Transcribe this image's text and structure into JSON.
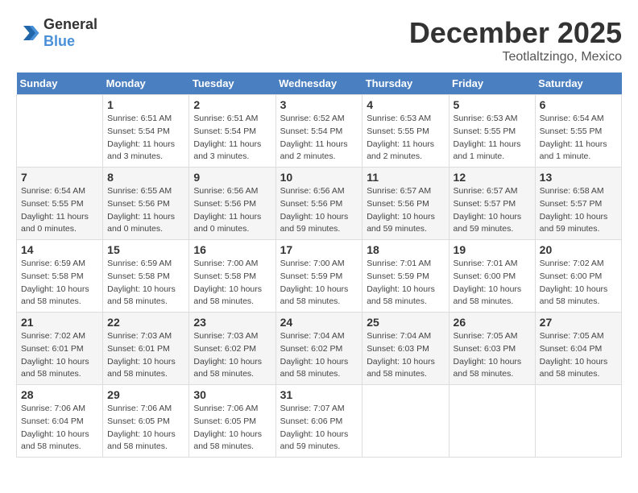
{
  "header": {
    "logo_general": "General",
    "logo_blue": "Blue",
    "month": "December 2025",
    "location": "Teotlaltzingo, Mexico"
  },
  "weekdays": [
    "Sunday",
    "Monday",
    "Tuesday",
    "Wednesday",
    "Thursday",
    "Friday",
    "Saturday"
  ],
  "weeks": [
    [
      {
        "day": "",
        "info": ""
      },
      {
        "day": "1",
        "info": "Sunrise: 6:51 AM\nSunset: 5:54 PM\nDaylight: 11 hours\nand 3 minutes."
      },
      {
        "day": "2",
        "info": "Sunrise: 6:51 AM\nSunset: 5:54 PM\nDaylight: 11 hours\nand 3 minutes."
      },
      {
        "day": "3",
        "info": "Sunrise: 6:52 AM\nSunset: 5:54 PM\nDaylight: 11 hours\nand 2 minutes."
      },
      {
        "day": "4",
        "info": "Sunrise: 6:53 AM\nSunset: 5:55 PM\nDaylight: 11 hours\nand 2 minutes."
      },
      {
        "day": "5",
        "info": "Sunrise: 6:53 AM\nSunset: 5:55 PM\nDaylight: 11 hours\nand 1 minute."
      },
      {
        "day": "6",
        "info": "Sunrise: 6:54 AM\nSunset: 5:55 PM\nDaylight: 11 hours\nand 1 minute."
      }
    ],
    [
      {
        "day": "7",
        "info": "Sunrise: 6:54 AM\nSunset: 5:55 PM\nDaylight: 11 hours\nand 0 minutes."
      },
      {
        "day": "8",
        "info": "Sunrise: 6:55 AM\nSunset: 5:56 PM\nDaylight: 11 hours\nand 0 minutes."
      },
      {
        "day": "9",
        "info": "Sunrise: 6:56 AM\nSunset: 5:56 PM\nDaylight: 11 hours\nand 0 minutes."
      },
      {
        "day": "10",
        "info": "Sunrise: 6:56 AM\nSunset: 5:56 PM\nDaylight: 10 hours\nand 59 minutes."
      },
      {
        "day": "11",
        "info": "Sunrise: 6:57 AM\nSunset: 5:56 PM\nDaylight: 10 hours\nand 59 minutes."
      },
      {
        "day": "12",
        "info": "Sunrise: 6:57 AM\nSunset: 5:57 PM\nDaylight: 10 hours\nand 59 minutes."
      },
      {
        "day": "13",
        "info": "Sunrise: 6:58 AM\nSunset: 5:57 PM\nDaylight: 10 hours\nand 59 minutes."
      }
    ],
    [
      {
        "day": "14",
        "info": "Sunrise: 6:59 AM\nSunset: 5:58 PM\nDaylight: 10 hours\nand 58 minutes."
      },
      {
        "day": "15",
        "info": "Sunrise: 6:59 AM\nSunset: 5:58 PM\nDaylight: 10 hours\nand 58 minutes."
      },
      {
        "day": "16",
        "info": "Sunrise: 7:00 AM\nSunset: 5:58 PM\nDaylight: 10 hours\nand 58 minutes."
      },
      {
        "day": "17",
        "info": "Sunrise: 7:00 AM\nSunset: 5:59 PM\nDaylight: 10 hours\nand 58 minutes."
      },
      {
        "day": "18",
        "info": "Sunrise: 7:01 AM\nSunset: 5:59 PM\nDaylight: 10 hours\nand 58 minutes."
      },
      {
        "day": "19",
        "info": "Sunrise: 7:01 AM\nSunset: 6:00 PM\nDaylight: 10 hours\nand 58 minutes."
      },
      {
        "day": "20",
        "info": "Sunrise: 7:02 AM\nSunset: 6:00 PM\nDaylight: 10 hours\nand 58 minutes."
      }
    ],
    [
      {
        "day": "21",
        "info": "Sunrise: 7:02 AM\nSunset: 6:01 PM\nDaylight: 10 hours\nand 58 minutes."
      },
      {
        "day": "22",
        "info": "Sunrise: 7:03 AM\nSunset: 6:01 PM\nDaylight: 10 hours\nand 58 minutes."
      },
      {
        "day": "23",
        "info": "Sunrise: 7:03 AM\nSunset: 6:02 PM\nDaylight: 10 hours\nand 58 minutes."
      },
      {
        "day": "24",
        "info": "Sunrise: 7:04 AM\nSunset: 6:02 PM\nDaylight: 10 hours\nand 58 minutes."
      },
      {
        "day": "25",
        "info": "Sunrise: 7:04 AM\nSunset: 6:03 PM\nDaylight: 10 hours\nand 58 minutes."
      },
      {
        "day": "26",
        "info": "Sunrise: 7:05 AM\nSunset: 6:03 PM\nDaylight: 10 hours\nand 58 minutes."
      },
      {
        "day": "27",
        "info": "Sunrise: 7:05 AM\nSunset: 6:04 PM\nDaylight: 10 hours\nand 58 minutes."
      }
    ],
    [
      {
        "day": "28",
        "info": "Sunrise: 7:06 AM\nSunset: 6:04 PM\nDaylight: 10 hours\nand 58 minutes."
      },
      {
        "day": "29",
        "info": "Sunrise: 7:06 AM\nSunset: 6:05 PM\nDaylight: 10 hours\nand 58 minutes."
      },
      {
        "day": "30",
        "info": "Sunrise: 7:06 AM\nSunset: 6:05 PM\nDaylight: 10 hours\nand 58 minutes."
      },
      {
        "day": "31",
        "info": "Sunrise: 7:07 AM\nSunset: 6:06 PM\nDaylight: 10 hours\nand 59 minutes."
      },
      {
        "day": "",
        "info": ""
      },
      {
        "day": "",
        "info": ""
      },
      {
        "day": "",
        "info": ""
      }
    ]
  ]
}
